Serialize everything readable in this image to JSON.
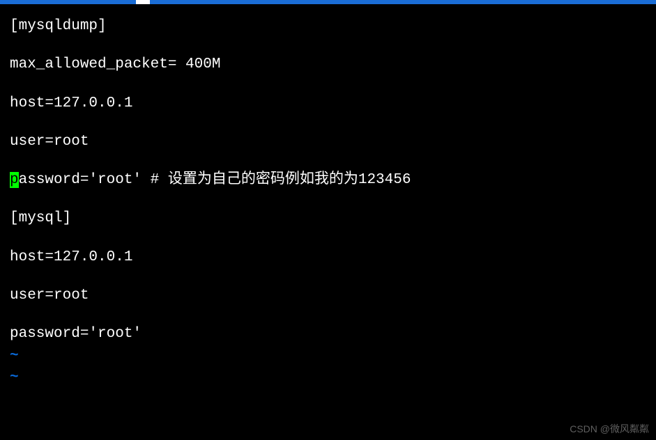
{
  "terminal": {
    "lines": [
      {
        "text": "[mysqldump]",
        "cursor_at": -1
      },
      {
        "text": "max_allowed_packet= 400M",
        "cursor_at": -1
      },
      {
        "text": "host=127.0.0.1",
        "cursor_at": -1
      },
      {
        "text": "user=root",
        "cursor_at": -1
      },
      {
        "text": "password='root' # 设置为自己的密码例如我的为123456",
        "cursor_at": 0
      },
      {
        "text": "[mysql]",
        "cursor_at": -1
      },
      {
        "text": "host=127.0.0.1",
        "cursor_at": -1
      },
      {
        "text": "user=root",
        "cursor_at": -1
      },
      {
        "text": "password='root'",
        "cursor_at": -1
      }
    ],
    "tildes": [
      "~",
      "~"
    ]
  },
  "watermark": "CSDN @微风粼粼"
}
